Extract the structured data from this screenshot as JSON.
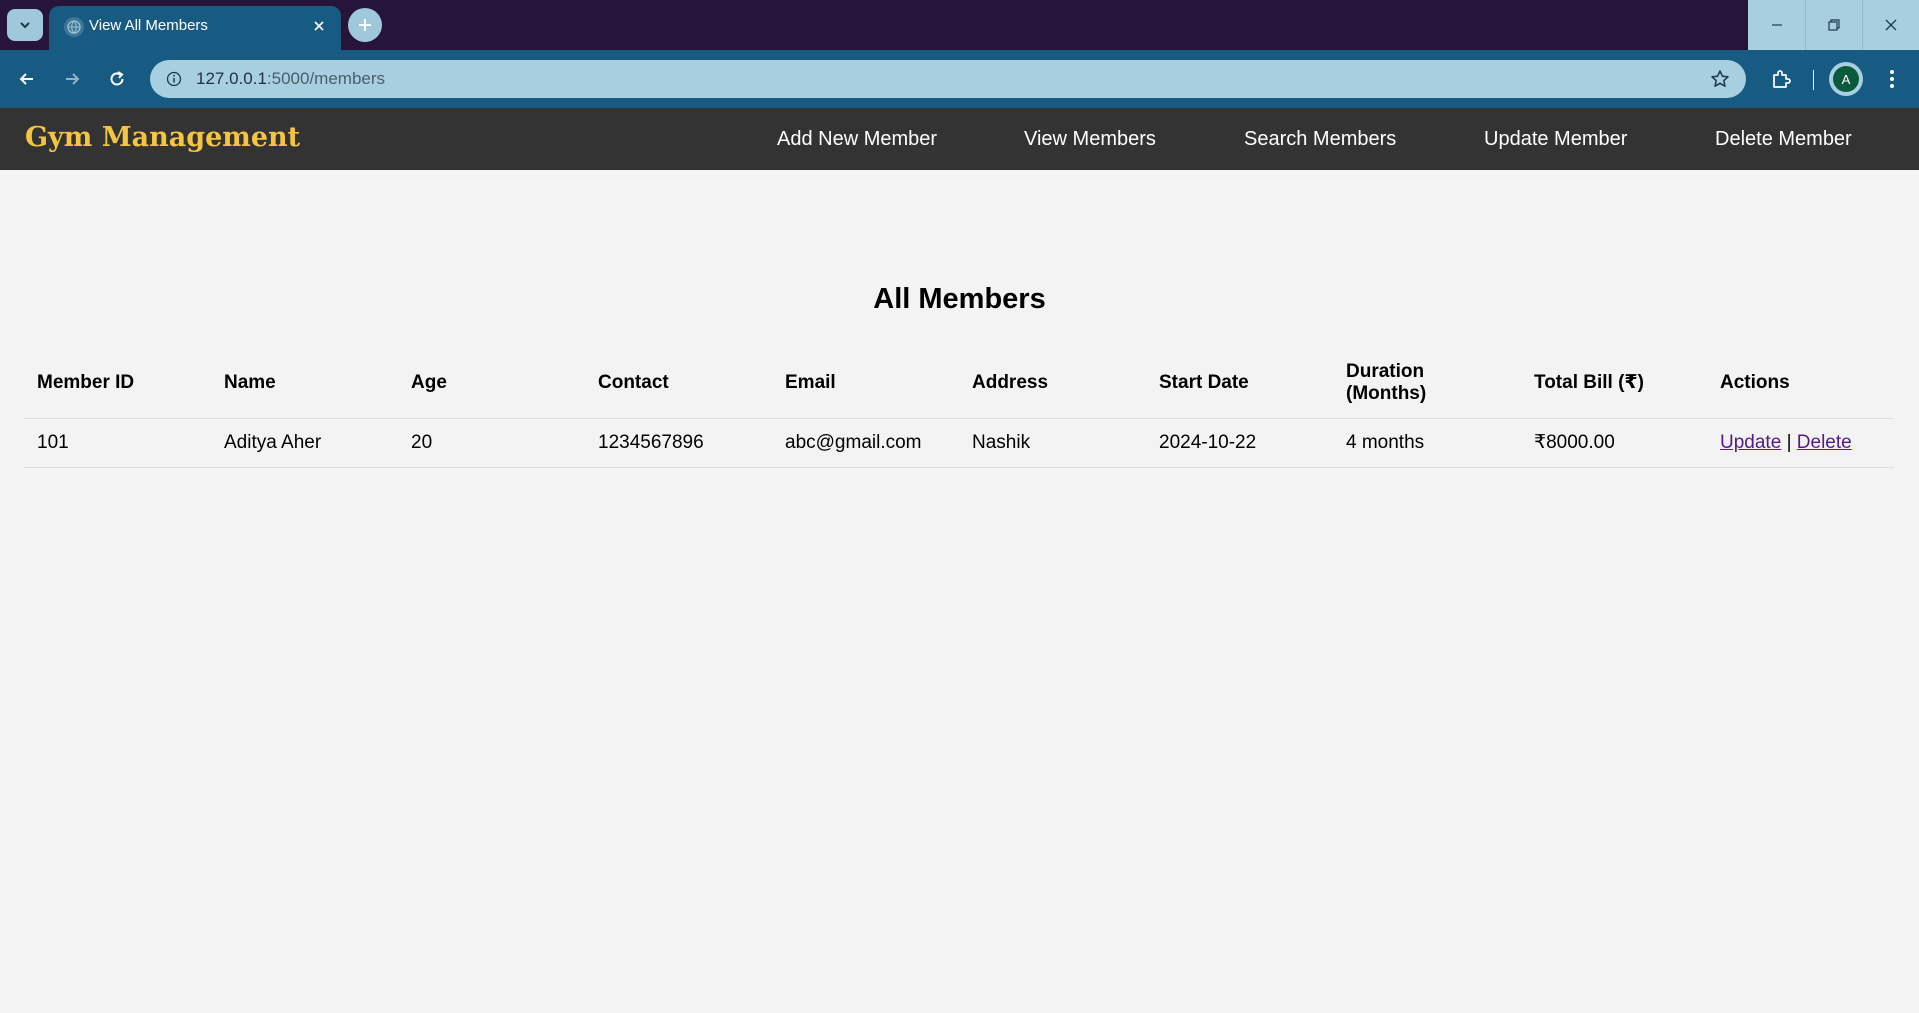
{
  "browser": {
    "tab_title": "View All Members",
    "url_host": "127.0.0.1",
    "url_path": ":5000/members",
    "avatar_letter": "A"
  },
  "site": {
    "brand": "Gym Management",
    "brand_color": "#f5c542",
    "nav_bg": "#333333",
    "nav": [
      {
        "label": "Add New Member"
      },
      {
        "label": "View Members"
      },
      {
        "label": "Search Members"
      },
      {
        "label": "Update Member"
      },
      {
        "label": "Delete Member"
      }
    ]
  },
  "main": {
    "title": "All Members",
    "table": {
      "headers": [
        "Member ID",
        "Name",
        "Age",
        "Contact",
        "Email",
        "Address",
        "Start Date",
        "Duration (Months)",
        "Total Bill (₹)",
        "Actions"
      ],
      "rows": [
        {
          "member_id": "101",
          "name": "Aditya Aher",
          "age": "20",
          "contact": "1234567896",
          "email": "abc@gmail.com",
          "address": "Nashik",
          "start_date": "2024-10-22",
          "duration": "4 months",
          "total_bill": "₹8000.00",
          "update_label": "Update",
          "separator": "|",
          "delete_label": "Delete"
        }
      ]
    }
  },
  "icons": {
    "tab_search": "chevron-down-icon",
    "favicon": "globe-icon",
    "tab_close": "close-icon",
    "new_tab": "plus-icon",
    "back": "arrow-left-icon",
    "forward": "arrow-right-icon",
    "reload": "reload-icon",
    "site_info": "info-icon",
    "bookmark": "star-icon",
    "extensions": "puzzle-icon",
    "menu": "kebab-menu-icon"
  }
}
